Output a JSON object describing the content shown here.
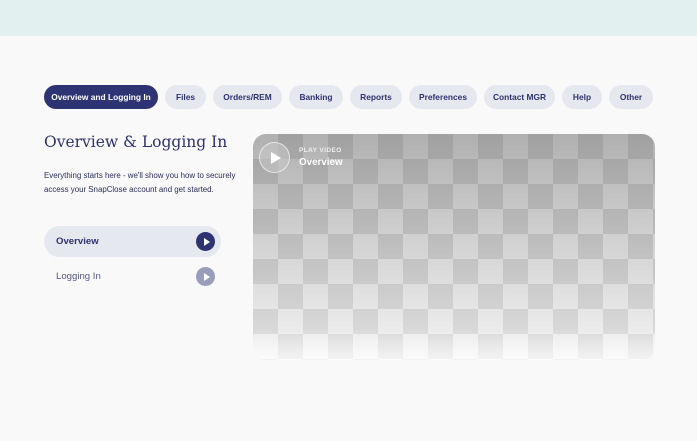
{
  "tabs": [
    {
      "label": "Overview and Logging In",
      "active": true
    },
    {
      "label": "Files",
      "active": false
    },
    {
      "label": "Orders/REM",
      "active": false
    },
    {
      "label": "Banking",
      "active": false
    },
    {
      "label": "Reports",
      "active": false
    },
    {
      "label": "Preferences",
      "active": false
    },
    {
      "label": "Contact MGR",
      "active": false
    },
    {
      "label": "Help",
      "active": false
    },
    {
      "label": "Other",
      "active": false
    }
  ],
  "section": {
    "title": "Overview & Logging In",
    "description": "Everything starts here - we'll show you how to securely access your SnapClose account and get started."
  },
  "videos": [
    {
      "label": "Overview",
      "selected": true
    },
    {
      "label": "Logging In",
      "selected": false
    }
  ],
  "player": {
    "kicker": "PLAY VIDEO",
    "title": "Overview"
  },
  "colors": {
    "accent": "#2e3373",
    "tab_bg": "#e6e8ef",
    "top_band": "#e3f0f0",
    "page_bg": "#f9f9fa",
    "inactive_play": "#9a9cbc"
  },
  "icons": {
    "list_play": "play-icon",
    "player_play": "play-icon"
  }
}
